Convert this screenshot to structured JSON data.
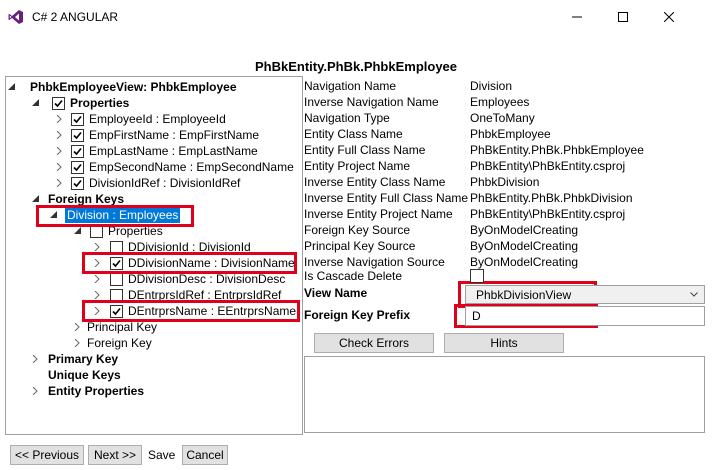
{
  "window": {
    "title": "C# 2 ANGULAR"
  },
  "heading": "PhBkEntity.PhBk.PhbkEmployee",
  "tree": {
    "root": "PhbkEmployeeView: PhbkEmployee",
    "properties": "Properties",
    "prop_items": [
      "EmployeeId : EmployeeId",
      "EmpFirstName : EmpFirstName",
      "EmpLastName : EmpLastName",
      "EmpSecondName : EmpSecondName",
      "DivisionIdRef : DivisionIdRef"
    ],
    "foreign_keys": "Foreign Keys",
    "division": "Division : Employees",
    "div_properties": "Properties",
    "div_items": [
      "DDivisionId : DivisionId",
      "DDivisionName : DivisionName",
      "DDivisionDesc : DivisionDesc",
      "DEntrprsIdRef : EntrprsIdRef",
      "DEntrprsName : EEntrprsName"
    ],
    "principal_key": "Principal Key",
    "foreign_key": "Foreign Key",
    "primary_key": "Primary Key",
    "unique_keys": "Unique Keys",
    "entity_properties": "Entity Properties"
  },
  "properties": [
    {
      "label": "Navigation Name",
      "value": "Division"
    },
    {
      "label": "Inverse Navigation Name",
      "value": "Employees"
    },
    {
      "label": "Navigation Type",
      "value": "OneToMany"
    },
    {
      "label": "Entity Class Name",
      "value": "PhbkEmployee"
    },
    {
      "label": "Entity Full Class Name",
      "value": "PhBkEntity.PhBk.PhbkEmployee"
    },
    {
      "label": "Entity Project Name",
      "value": "PhBkEntity\\PhBkEntity.csproj"
    },
    {
      "label": "Inverse Entity Class Name",
      "value": "PhbkDivision"
    },
    {
      "label": "Inverse Entity Full Class Name",
      "value": "PhBkEntity.PhBk.PhbkDivision"
    },
    {
      "label": "Inverse Entity Project Name",
      "value": "PhBkEntity\\PhBkEntity.csproj"
    },
    {
      "label": "Foreign Key Source",
      "value": "ByOnModelCreating"
    },
    {
      "label": "Principal Key Source",
      "value": "ByOnModelCreating"
    },
    {
      "label": "Inverse Navigation Source",
      "value": "ByOnModelCreating"
    }
  ],
  "cascade_label": "Is Cascade Delete",
  "view_name": {
    "label": "View Name",
    "value": "PhbkDivisionView"
  },
  "fk_prefix": {
    "label": "Foreign Key Prefix",
    "value": "D"
  },
  "buttons": {
    "check_errors": "Check Errors",
    "hints": "Hints"
  },
  "bottom": {
    "previous": "<< Previous",
    "next": "Next >>",
    "save": "Save",
    "cancel": "Cancel"
  }
}
